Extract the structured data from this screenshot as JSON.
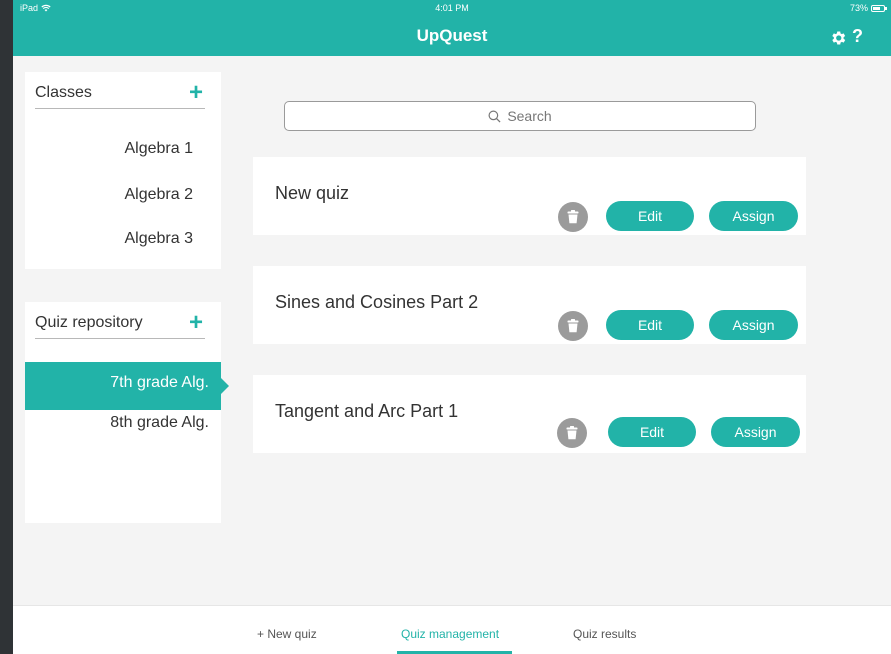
{
  "status_bar": {
    "carrier": "iPad",
    "time": "4:01 PM",
    "battery": "73%",
    "battery_level": 0.73
  },
  "header": {
    "title": "UpQuest",
    "help_label": "?"
  },
  "classes": {
    "title": "Classes",
    "add_label": "+",
    "items": [
      "Algebra 1",
      "Algebra 2",
      "Algebra 3"
    ]
  },
  "repository": {
    "title": "Quiz repository",
    "add_label": "+",
    "items": [
      "7th grade Alg.",
      "8th grade Alg."
    ],
    "selected_index": 0
  },
  "search": {
    "placeholder": "Search"
  },
  "quizzes": [
    {
      "title": "New quiz",
      "edit_label": "Edit",
      "assign_label": "Assign"
    },
    {
      "title": "Sines and Cosines Part 2",
      "edit_label": "Edit",
      "assign_label": "Assign"
    },
    {
      "title": "Tangent and Arc Part 1",
      "edit_label": "Edit",
      "assign_label": "Assign"
    }
  ],
  "bottom_tabs": {
    "new_quiz": "+ New quiz",
    "quiz_management": "Quiz management",
    "quiz_results": "Quiz results",
    "active": "quiz_management"
  },
  "icons": {
    "settings": "gear-icon",
    "help": "help-icon",
    "search": "search-icon",
    "delete": "trash-icon",
    "wifi": "wifi-icon",
    "battery": "battery-icon"
  },
  "colors": {
    "accent": "#22b3a8",
    "background": "#f4f4f4",
    "trash_button": "#9b9b9b"
  }
}
